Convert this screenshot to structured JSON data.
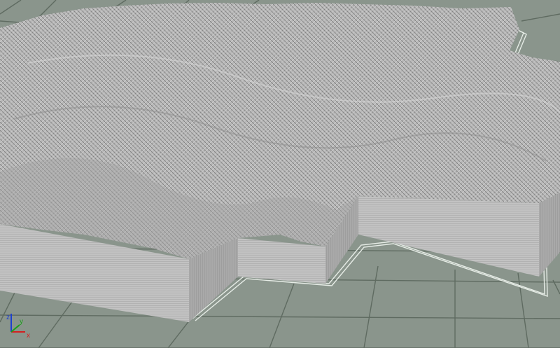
{
  "viewport": {
    "background_color": "#8a958c",
    "grid_color": "#5f6b61",
    "terrain_top_color": "#b8b8b8",
    "terrain_side_color": "#c4c4c4",
    "outline_color": "#e6ece6"
  },
  "axis_gizmo": {
    "x_label": "x",
    "y_label": "y",
    "z_label": "z",
    "x_color": "#d42020",
    "y_color": "#18a018",
    "z_color": "#1c3fd0"
  }
}
